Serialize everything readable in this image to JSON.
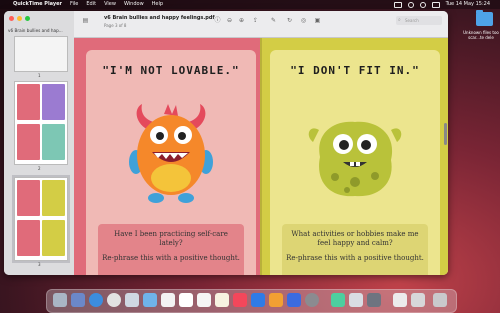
{
  "menubar": {
    "apple": "",
    "app_name": "QuickTime Player",
    "items": [
      "File",
      "Edit",
      "View",
      "Window",
      "Help"
    ],
    "clock": "Tue 14 May  15:24"
  },
  "window": {
    "doc_title": "v6 Brain bullies and happy feelings.pdf",
    "doc_subtitle": "Page 3 of 8",
    "search_placeholder": "Search"
  },
  "sidebar": {
    "title": "v6 Brain bullies and hap...",
    "pages": [
      "1",
      "2",
      "3"
    ]
  },
  "page_left": {
    "headline": "\"I'M NOT LOVABLE.\"",
    "question": "Have I been practicing self-care lately?",
    "reframe": "Re-phrase this with a positive thought."
  },
  "page_right": {
    "headline": "\"I DON'T FIT IN.\"",
    "question": "What activities or hobbies make me feel happy and calm?",
    "reframe": "Re-phrase this with a positive thought."
  },
  "desktop": {
    "folder_label": "Unknown files too scar...te dele"
  },
  "colors": {
    "left_bg": "#e06b7a",
    "left_card": "#f0b9b5",
    "right_bg": "#d3cd45",
    "right_card": "#ece58e"
  }
}
